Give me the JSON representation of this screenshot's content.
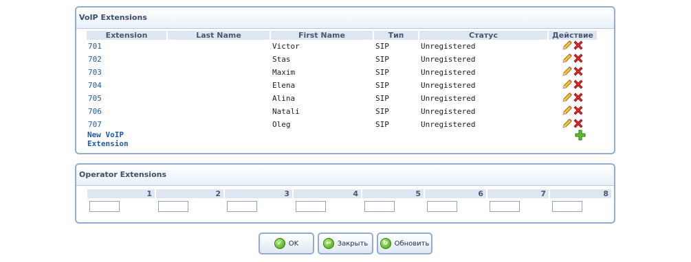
{
  "voip": {
    "title": "VoIP Extensions",
    "columns": {
      "extension": "Extension",
      "last_name": "Last Name",
      "first_name": "First Name",
      "type": "Тип",
      "status": "Статус",
      "action": "Действие"
    },
    "rows": [
      {
        "ext": "701",
        "last": "",
        "first": "Victor",
        "type": "SIP",
        "status": "Unregistered"
      },
      {
        "ext": "702",
        "last": "",
        "first": "Stas",
        "type": "SIP",
        "status": "Unregistered"
      },
      {
        "ext": "703",
        "last": "",
        "first": "Maxim",
        "type": "SIP",
        "status": "Unregistered"
      },
      {
        "ext": "704",
        "last": "",
        "first": "Elena",
        "type": "SIP",
        "status": "Unregistered"
      },
      {
        "ext": "705",
        "last": "",
        "first": "Alina",
        "type": "SIP",
        "status": "Unregistered"
      },
      {
        "ext": "706",
        "last": "",
        "first": "Natali",
        "type": "SIP",
        "status": "Unregistered"
      },
      {
        "ext": "707",
        "last": "",
        "first": "Oleg",
        "type": "SIP",
        "status": "Unregistered"
      }
    ],
    "new_link": {
      "line1": "New VoIP",
      "line2": "Extension"
    },
    "icons": {
      "edit": "pencil-icon",
      "delete": "red-x-icon",
      "add": "green-plus-icon"
    }
  },
  "operator": {
    "title": "Operator Extensions",
    "columns": [
      "1",
      "2",
      "3",
      "4",
      "5",
      "6",
      "7",
      "8"
    ],
    "values": [
      "",
      "",
      "",
      "",
      "",
      "",
      "",
      ""
    ]
  },
  "buttons": {
    "ok": "OK",
    "close": "Закрыть",
    "refresh": "Обновить"
  },
  "colors": {
    "panel_border": "#90acd0",
    "header_bg": "#dde6f1",
    "link": "#1f5aa6",
    "delete_red": "#d9282c",
    "ok_green": "#3c9a16"
  }
}
